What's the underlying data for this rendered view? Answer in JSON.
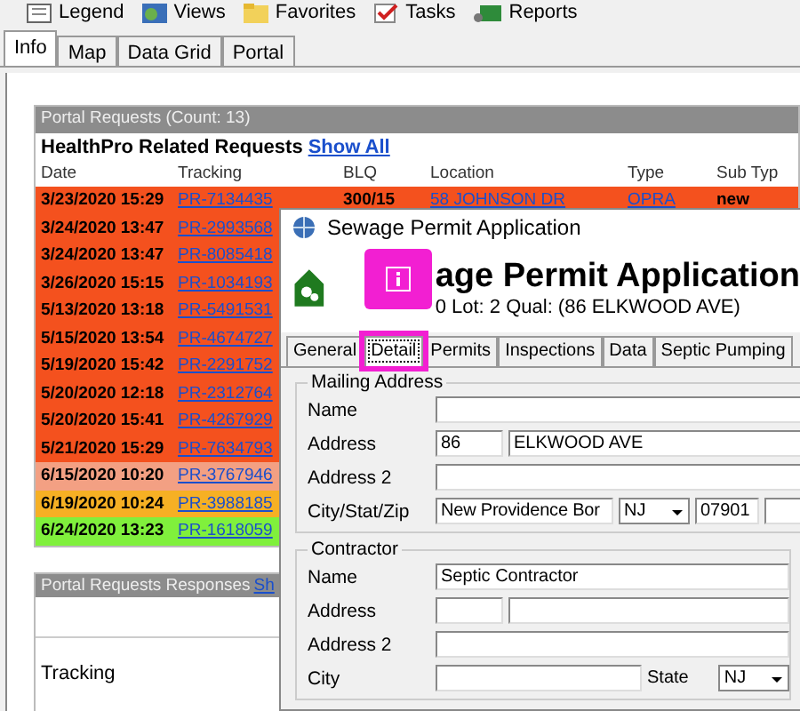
{
  "toolbar": [
    {
      "label": "Legend",
      "kind": "legend"
    },
    {
      "label": "Views",
      "kind": "views"
    },
    {
      "label": "Favorites",
      "kind": "favorites"
    },
    {
      "label": "Tasks",
      "kind": "tasks"
    },
    {
      "label": "Reports",
      "kind": "reports"
    }
  ],
  "tabs": [
    {
      "label": "Info",
      "selected": true
    },
    {
      "label": "Map",
      "selected": false
    },
    {
      "label": "Data Grid",
      "selected": false
    },
    {
      "label": "Portal",
      "selected": false
    }
  ],
  "portal_panel": {
    "title": "Portal Requests (Count: 13)",
    "subtitle": "HealthPro Related Requests",
    "link": "Show All",
    "columns": [
      "Date",
      "Tracking",
      "BLQ",
      "Location",
      "Type",
      "Sub Typ"
    ],
    "rows": [
      {
        "date": "3/23/2020 15:29",
        "tracking": "PR-7134435",
        "blq": "300/15",
        "location": "58 JOHNSON DR",
        "type": "OPRA",
        "sub_type": "new",
        "color": "#f4511e"
      },
      {
        "date": "3/24/2020 13:47",
        "tracking": "PR-2993568",
        "color": "#f4511e"
      },
      {
        "date": "3/24/2020 13:47",
        "tracking": "PR-8085418",
        "color": "#f4511e"
      },
      {
        "date": "3/26/2020 15:15",
        "tracking": "PR-1034193",
        "color": "#f4511e"
      },
      {
        "date": "5/13/2020 13:18",
        "tracking": "PR-5491531",
        "color": "#f4511e"
      },
      {
        "date": "5/15/2020 13:54",
        "tracking": "PR-4674727",
        "color": "#f4511e"
      },
      {
        "date": "5/19/2020 15:42",
        "tracking": "PR-2291752",
        "color": "#f4511e"
      },
      {
        "date": "5/20/2020 12:18",
        "tracking": "PR-2312764",
        "color": "#f4511e"
      },
      {
        "date": "5/20/2020 15:41",
        "tracking": "PR-4267929",
        "color": "#f4511e"
      },
      {
        "date": "5/21/2020 15:29",
        "tracking": "PR-7634793",
        "color": "#f4511e"
      },
      {
        "date": "6/15/2020 10:20",
        "tracking": "PR-3767946",
        "color": "#f3a083"
      },
      {
        "date": "6/19/2020 10:24",
        "tracking": "PR-3988185",
        "color": "#f6b024"
      },
      {
        "date": "6/24/2020 13:23",
        "tracking": "PR-1618059",
        "color": "#80f03c"
      }
    ]
  },
  "responses_panel": {
    "title": "Portal Requests Responses",
    "link": "Sh",
    "columns": [
      "Tracking"
    ]
  },
  "dialog": {
    "title": "Sewage Permit Application",
    "heading": "age Permit Application",
    "subheading": "0 Lot: 2 Qual:  (86 ELKWOOD AVE)",
    "callout": true,
    "tabs": [
      {
        "label": "General",
        "selected": false,
        "highlighted": false
      },
      {
        "label": "Detail",
        "selected": true,
        "highlighted": true
      },
      {
        "label": "Permits",
        "selected": false,
        "highlighted": false
      },
      {
        "label": "Inspections",
        "selected": false,
        "highlighted": false
      },
      {
        "label": "Data",
        "selected": false,
        "highlighted": false
      },
      {
        "label": "Septic Pumping",
        "selected": false,
        "highlighted": false
      }
    ],
    "groups": [
      {
        "title": "Mailing Address",
        "rows": [
          {
            "label": "Name",
            "fields": [
              {
                "kind": "text"
              }
            ]
          },
          {
            "label": "Address",
            "fields": [
              {
                "kind": "number",
                "value": "86"
              },
              {
                "kind": "text",
                "value": "ELKWOOD AVE"
              }
            ]
          },
          {
            "label": "Address 2",
            "fields": [
              {
                "kind": "text"
              }
            ]
          },
          {
            "label": "City/Stat/Zip",
            "fields": [
              {
                "kind": "city",
                "value": "New Providence Bor"
              },
              {
                "kind": "select",
                "value": "NJ"
              },
              {
                "kind": "zip",
                "value": "07901"
              },
              {
                "kind": "text"
              }
            ]
          }
        ]
      },
      {
        "title": "Contractor",
        "rows": [
          {
            "label": "Name",
            "fields": [
              {
                "kind": "text",
                "value": "Septic Contractor"
              }
            ]
          },
          {
            "label": "Address",
            "fields": [
              {
                "kind": "number"
              },
              {
                "kind": "text"
              }
            ]
          },
          {
            "label": "Address 2",
            "fields": [
              {
                "kind": "text"
              }
            ]
          },
          {
            "label": "City",
            "fields": [
              {
                "kind": "wide"
              },
              {
                "kind": "label",
                "value": "State"
              },
              {
                "kind": "select",
                "value": "NJ"
              }
            ]
          }
        ]
      }
    ]
  }
}
